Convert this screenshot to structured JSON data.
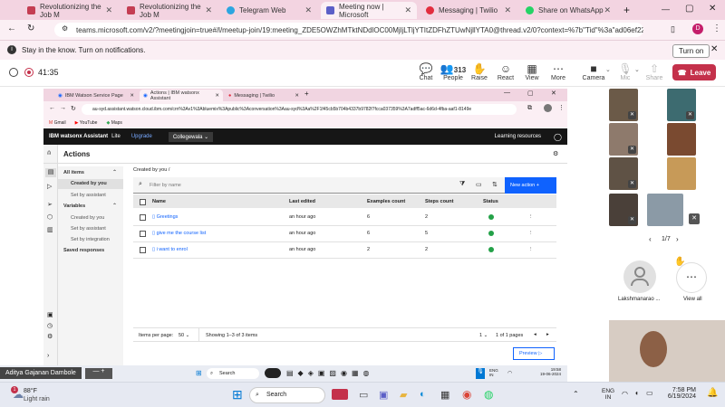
{
  "browser": {
    "tabs": [
      {
        "title": "Revolutionizing the Job M",
        "color": "#c43d52"
      },
      {
        "title": "Revolutionizing the Job M",
        "color": "#c43d52"
      },
      {
        "title": "Telegram Web",
        "color": "#2ca5e0"
      },
      {
        "title": "Meeting now | Microsoft",
        "color": "#5b5fc7"
      },
      {
        "title": "Messaging | Twilio",
        "color": "#e22d3e"
      },
      {
        "title": "Share on WhatsApp",
        "color": "#25d366"
      }
    ],
    "new_tab": "+",
    "url": "teams.microsoft.com/v2/?meetingjoin=true#/l/meetup-join/19:meeting_ZDE5OWZhMTktNDdlOC00MjljLTljYTItZDFhZTUwNjllYTA0@thread.v2/0?context=%7b\"Tid\"%3a\"ad06ef22-d6dc-4a55-b",
    "profile_initial": "D",
    "notification": "Stay in the know. Turn on notifications.",
    "turn_on": "Turn on"
  },
  "teams": {
    "timer": "41:35",
    "toolbar": [
      {
        "label": "Chat",
        "glyph": "💬"
      },
      {
        "label": "People",
        "glyph": "👥",
        "count": "313"
      },
      {
        "label": "Raise",
        "glyph": "✋"
      },
      {
        "label": "React",
        "glyph": "☺"
      },
      {
        "label": "View",
        "glyph": "▦"
      },
      {
        "label": "More",
        "glyph": "⋯"
      },
      {
        "label": "Camera",
        "glyph": "■"
      },
      {
        "label": "Mic",
        "glyph": "🎙"
      },
      {
        "label": "Share",
        "glyph": "⇧"
      }
    ],
    "leave": "Leave",
    "page_indicator": "1/7",
    "participant_name": "Lakshmanarao ...",
    "view_all": "View all",
    "presenter": "Aditya Gajanan Dambole"
  },
  "shared": {
    "tabs": [
      "IBM Watson Service Page",
      "Actions | IBM watsonx Assistant",
      "Messaging | Twilio"
    ],
    "url": "au-syd.assistant.watson.cloud.ibm.com/crn%3Av1%3Abluemix%3Apublic%3Aconversation%3Aau-syd%3Aa%2F1f45cb5b704b4337b9782f7fcca037359%3A7adff5ac-6d6d-4fba-aaf1-8149e",
    "bookmarks": [
      "Gmail",
      "YouTube",
      "Maps"
    ],
    "ibm": {
      "brand": "IBM watsonx Assistant",
      "plan": "Lite",
      "upgrade": "Upgrade",
      "workspace": "Collegewala",
      "learning": "Learning resources"
    },
    "page_title": "Actions",
    "nav": {
      "all_items": "All items",
      "created_by_you": "Created by you",
      "set_by_assistant": "Set by assistant",
      "variables": "Variables",
      "var_created_by_you": "Created by you",
      "var_set_by_assistant": "Set by assistant",
      "set_by_integration": "Set by integration",
      "saved_responses": "Saved responses"
    },
    "breadcrumb": "Created by you  /",
    "filter_placeholder": "Filter by name",
    "new_action": "New action  +",
    "columns": {
      "name": "Name",
      "last_edited": "Last edited",
      "examples": "Examples count",
      "steps": "Steps count",
      "status": "Status"
    },
    "rows": [
      {
        "name": "Greetings",
        "last_edited": "an hour ago",
        "examples": "6",
        "steps": "2"
      },
      {
        "name": "give me the course list",
        "last_edited": "an hour ago",
        "examples": "6",
        "steps": "5"
      },
      {
        "name": "i want to enrol",
        "last_edited": "an hour ago",
        "examples": "2",
        "steps": "2"
      }
    ],
    "pagination": {
      "items_per_page": "Items per page:",
      "per_page": "50",
      "range": "Showing 1–3 of 3 items",
      "page": "1",
      "of_pages": "1 of 1 pages"
    },
    "preview": "Preview",
    "taskbar": {
      "search": "Search",
      "lang": "ENG\nIN",
      "time": "19:58",
      "date": "19-06-2024"
    }
  },
  "taskbar": {
    "weather_temp": "88°F",
    "weather_desc": "Light rain",
    "weather_badge": "1",
    "search": "Search",
    "lang1": "ENG",
    "lang2": "IN",
    "time": "7:58 PM",
    "date": "6/19/2024"
  }
}
